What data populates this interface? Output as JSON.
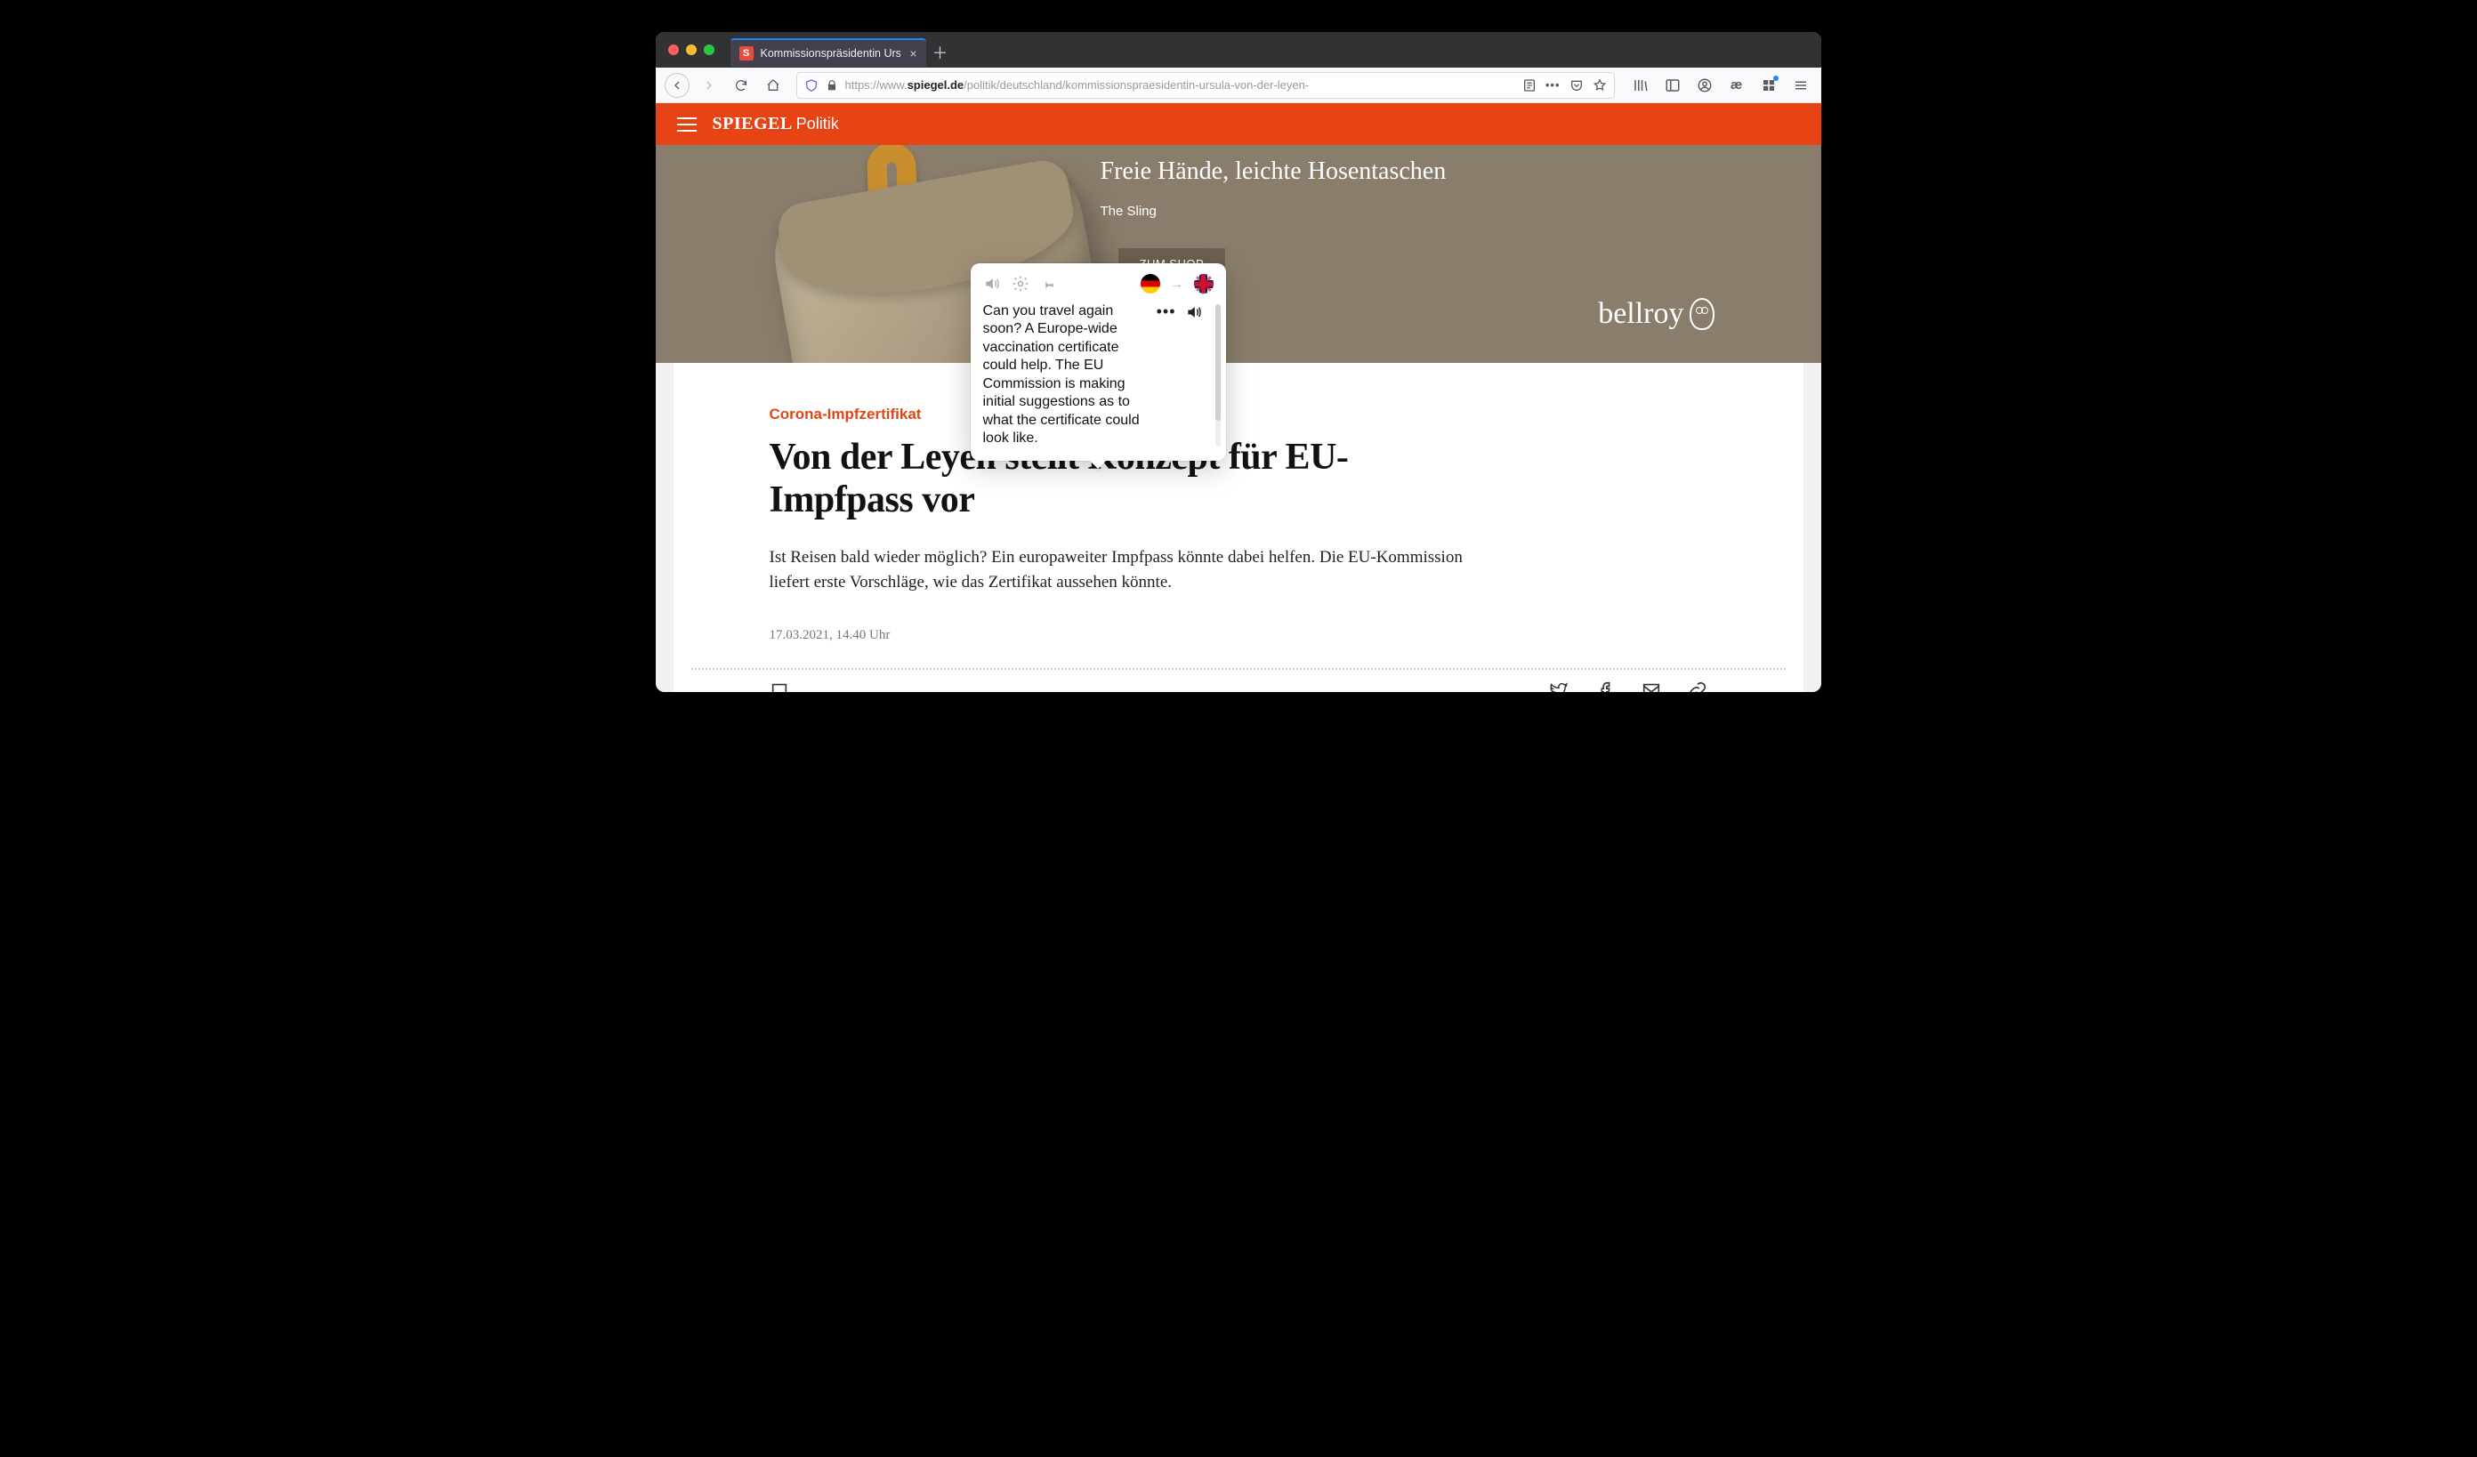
{
  "browser": {
    "tab_title": "Kommissionspräsidentin Ursula",
    "url_prefix": "https://www.",
    "url_domain": "spiegel.de",
    "url_path": "/politik/deutschland/kommissionspraesidentin-ursula-von-der-leyen-"
  },
  "site": {
    "brand": "SPIEGEL",
    "section": "Politik"
  },
  "ad": {
    "headline": "Freie Hände, leichte Hosentaschen",
    "sub": "The Sling",
    "cta": "ZUM SHOP",
    "brand": "bellroy"
  },
  "article": {
    "kicker": "Corona-Impfzertifikat",
    "headline": "Von der Leyen stellt Konzept für EU-Impfpass vor",
    "lede": "Ist Reisen bald wieder möglich? Ein europaweiter Impfpass könnte dabei helfen. Die EU-Kommission liefert erste Vorschläge, wie das Zertifikat aussehen könnte.",
    "meta": "17.03.2021, 14.40 Uhr"
  },
  "popup": {
    "translation": "Can you travel again soon? A Europe-wide vaccination certificate could help. The EU Commission is making initial suggestions as to what the certificate could look like.",
    "lang_arrow": "→"
  }
}
